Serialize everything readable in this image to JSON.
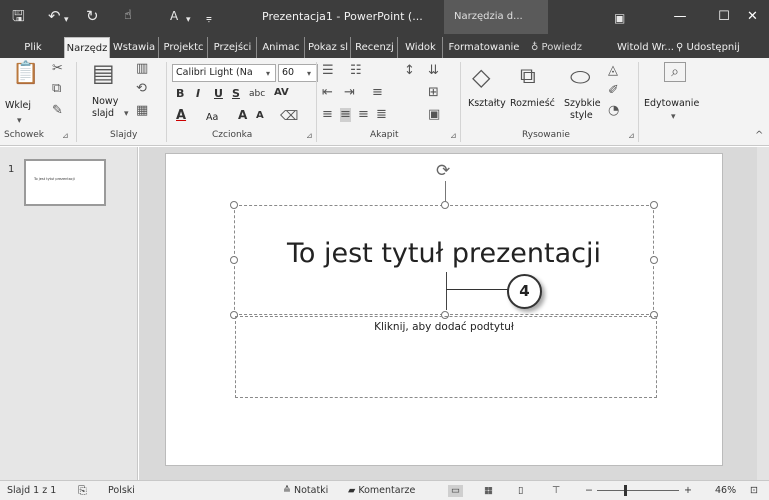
{
  "titlebar": {
    "title": "Prezentacja1 - PowerPoint (...",
    "tools_context": "Narzędzia d...",
    "icons": [
      "save-icon",
      "undo-icon",
      "redo-icon",
      "touch-mode-icon",
      "font-color-quick-icon",
      "customize-icon"
    ]
  },
  "tabs": [
    "Plik",
    "Narzędz",
    "Wstawia",
    "Projektc",
    "Przejści",
    "Animac",
    "Pokaz sl",
    "Recenzj",
    "Widok",
    "Formatowanie"
  ],
  "search": {
    "label": "Powiedz"
  },
  "user": {
    "name": "Witold Wr..."
  },
  "share": {
    "label": "Udostępnij"
  },
  "ribbon": {
    "clipboard": {
      "group": "Schowek",
      "paste": "Wklej"
    },
    "slides": {
      "group": "Slajdy",
      "new_slide_1": "Nowy",
      "new_slide_2": "slajd"
    },
    "font": {
      "group": "Czcionka",
      "family": "Calibri Light (Na",
      "size": "60",
      "case": "Aa"
    },
    "paragraph": {
      "group": "Akapit"
    },
    "drawing": {
      "group": "Rysowanie",
      "shapes": "Kształty",
      "arrange": "Rozmieść",
      "quick_styles_1": "Szybkie",
      "quick_styles_2": "style"
    },
    "editing": {
      "label": "Edytowanie"
    }
  },
  "thumbnail": {
    "number": "1",
    "text": "To jest tytuł prezentacji"
  },
  "slide": {
    "title": "To jest tytuł prezentacji",
    "subtitle": "Kliknij, aby dodać podtytuł",
    "callout": "4"
  },
  "status": {
    "slide_info": "Slajd 1 z 1",
    "language": "Polski",
    "notes": "Notatki",
    "comments": "Komentarze",
    "zoom": "46%"
  }
}
